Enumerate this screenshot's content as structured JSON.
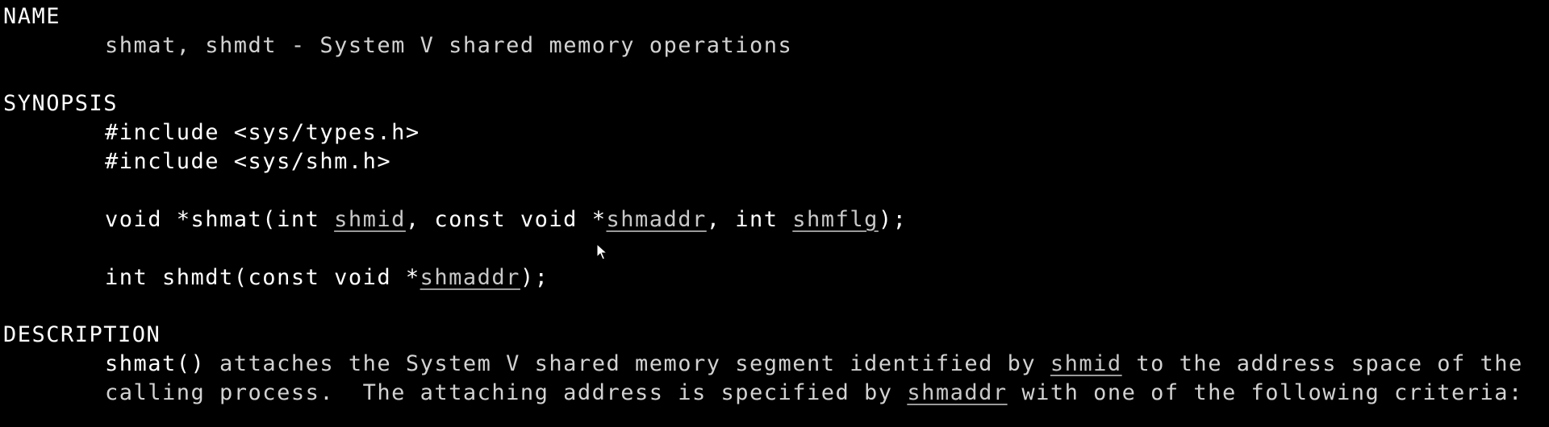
{
  "man_page": {
    "name_section": {
      "heading": "NAME",
      "funcs": "shmat, shmdt",
      "dash": " - ",
      "desc": "System V shared memory operations"
    },
    "synopsis_section": {
      "heading": "SYNOPSIS",
      "include1": "#include <sys/types.h>",
      "include2": "#include <sys/shm.h>",
      "shmat_sig": {
        "pre": "void *shmat(int ",
        "arg1": "shmid",
        "mid1": ", const void *",
        "arg2": "shmaddr",
        "mid2": ", int ",
        "arg3": "shmflg",
        "post": ");"
      },
      "shmdt_sig": {
        "pre": "int shmdt(const void *",
        "arg1": "shmaddr",
        "post": ");"
      }
    },
    "description_section": {
      "heading": "DESCRIPTION",
      "line1": {
        "func": "shmat()",
        "t1": " attaches the System V shared memory segment identified by ",
        "arg1": "shmid",
        "t2": " to the address space of the"
      },
      "line2": {
        "t1": "calling process.  The attaching address is specified by ",
        "arg1": "shmaddr",
        "t2": " with one of the following criteria:"
      }
    }
  },
  "colors": {
    "background": "#000000",
    "heading": "#ffffff",
    "body_text": "#d2d2d2",
    "underlined_arg": "#c8c8c8"
  },
  "icons": {
    "pointer": "mouse-pointer-icon"
  }
}
